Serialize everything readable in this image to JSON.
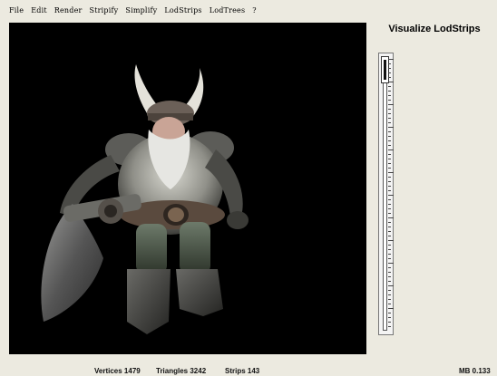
{
  "menu": [
    {
      "label": "File"
    },
    {
      "label": "Edit"
    },
    {
      "label": "Render"
    },
    {
      "label": "Stripify"
    },
    {
      "label": "Simplify"
    },
    {
      "label": "LodStrips"
    },
    {
      "label": "LodTrees"
    },
    {
      "label": "?"
    }
  ],
  "panel": {
    "title": "Visualize LodStrips",
    "lod_level": 0.0
  },
  "status": {
    "vertices": "Vertices 1479",
    "triangles": "Triangles 3242",
    "strips": "Strips 143",
    "memory": "MB 0.133"
  },
  "colors": {
    "viewport_bg": "#000000",
    "window_bg": "#eceae0"
  }
}
